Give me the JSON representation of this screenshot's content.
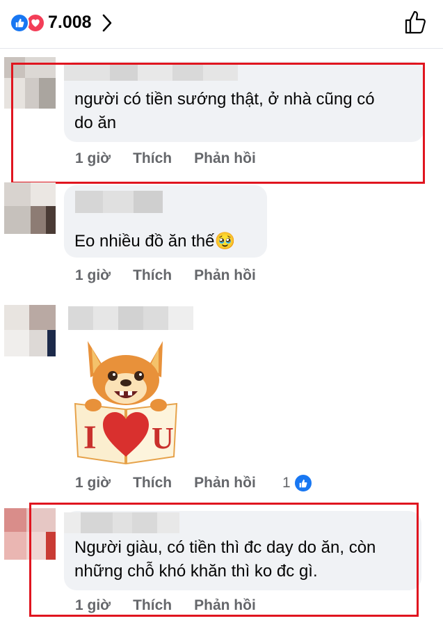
{
  "header": {
    "reaction_count": "7.008",
    "reaction_icons": [
      "like-icon",
      "love-icon"
    ],
    "chevron_icon": "chevron-right-icon",
    "like_button_icon": "thumbs-up-outline-icon"
  },
  "comments": [
    {
      "text": "người có tiền sướng thật, ở nhà cũng có\ndo ăn",
      "time": "1 giờ",
      "like_label": "Thích",
      "reply_label": "Phản hồi"
    },
    {
      "text": "Eo nhiều đồ ăn thế",
      "emoji": "🥹",
      "time": "1 giờ",
      "like_label": "Thích",
      "reply_label": "Phản hồi"
    },
    {
      "sticker": "i-love-u-dog-sticker",
      "sticker_text": "I U",
      "time": "1 giờ",
      "like_label": "Thích",
      "reply_label": "Phản hồi",
      "like_count": "1"
    },
    {
      "text": "Người giàu, có tiền thì đc day do ăn, còn\nnhững chỗ khó khăn thì ko đc gì.",
      "time": "1 giờ",
      "like_label": "Thích",
      "reply_label": "Phản hồi"
    }
  ],
  "colors": {
    "like_blue": "#1877f2",
    "love_red": "#f33e58",
    "highlight_red": "#e0151f",
    "bubble_gray": "#f0f2f5",
    "meta_gray": "#65676b"
  }
}
